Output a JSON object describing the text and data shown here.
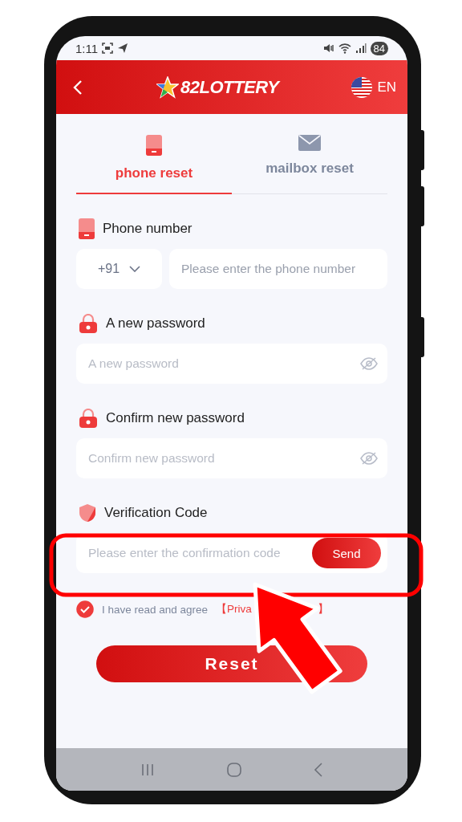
{
  "status_bar": {
    "time": "1:11",
    "battery": "84"
  },
  "header": {
    "title": "82LOTTERY",
    "language": "EN"
  },
  "tabs": [
    {
      "kind": "phone",
      "label": "phone reset",
      "selected": true
    },
    {
      "kind": "mail",
      "label": "mailbox reset",
      "selected": false
    }
  ],
  "fields": [
    {
      "kind": "phone",
      "label": "Phone number",
      "code": "+91",
      "placeholder": "Please enter the phone number"
    },
    {
      "kind": "password",
      "label": "A new password",
      "placeholder": "A new password"
    },
    {
      "kind": "password",
      "label": "Confirm new password",
      "placeholder": "Confirm new password"
    },
    {
      "kind": "code",
      "label": "Verification Code",
      "placeholder": "Please enter the confirmation code",
      "button": "Send"
    }
  ],
  "agreement": {
    "checked": true,
    "text": "I have read and agree",
    "link_start": "【Priva",
    "link_end": "】"
  },
  "reset_button": "Reset"
}
